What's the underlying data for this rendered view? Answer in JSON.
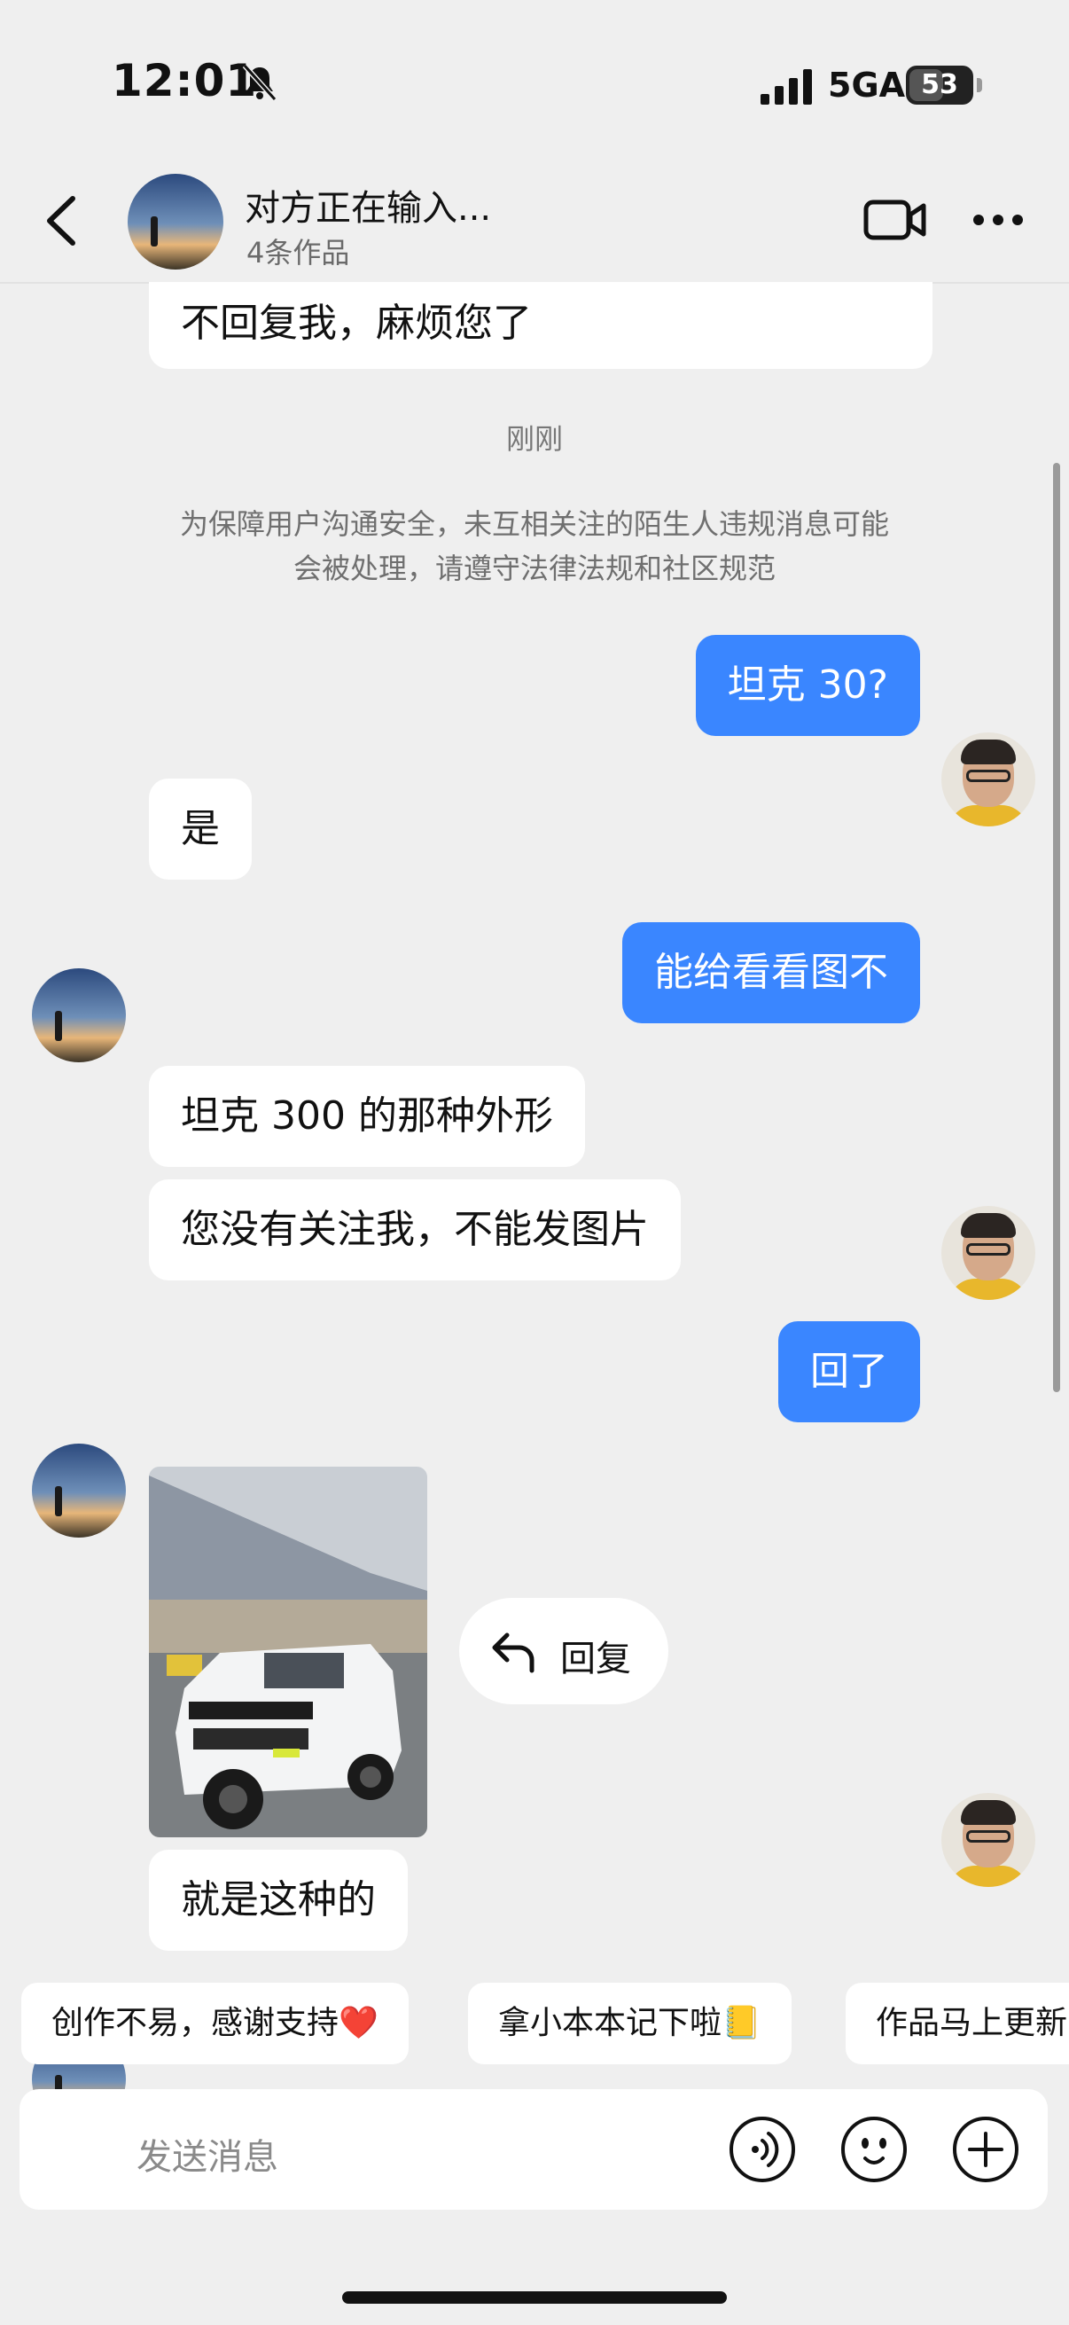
{
  "status": {
    "time": "12:01",
    "network": "5GA",
    "battery": "53"
  },
  "header": {
    "title": "对方正在输入...",
    "subtitle": "4条作品"
  },
  "messages": {
    "prev": "不回复我，麻烦您了",
    "time_label": "刚刚",
    "safety_notice_line1": "为保障用户沟通安全，未互相关注的陌生人违规消息可能",
    "safety_notice_line2": "会被处理，请遵守法律法规和社区规范",
    "m1": "坦克 30?",
    "m2": "是",
    "m3": "能给看看图不",
    "m4": "坦克 300 的那种外形",
    "m5": "您没有关注我，不能发图片",
    "m6": "回了",
    "m7": "就是这种的"
  },
  "reply_button": "回复",
  "quick_phrases": [
    "创作不易，感谢支持❤️",
    "拿小本本记下啦📒",
    "作品马上更新"
  ],
  "input": {
    "placeholder": "发送消息"
  },
  "colors": {
    "accent": "#3a86ff",
    "background": "#efefef"
  },
  "icons": [
    "bell-off-icon",
    "signal-icon",
    "battery-icon",
    "back-arrow-icon",
    "video-call-icon",
    "more-icon",
    "reply-arrow-icon",
    "voice-icon",
    "emoji-icon",
    "plus-icon"
  ]
}
